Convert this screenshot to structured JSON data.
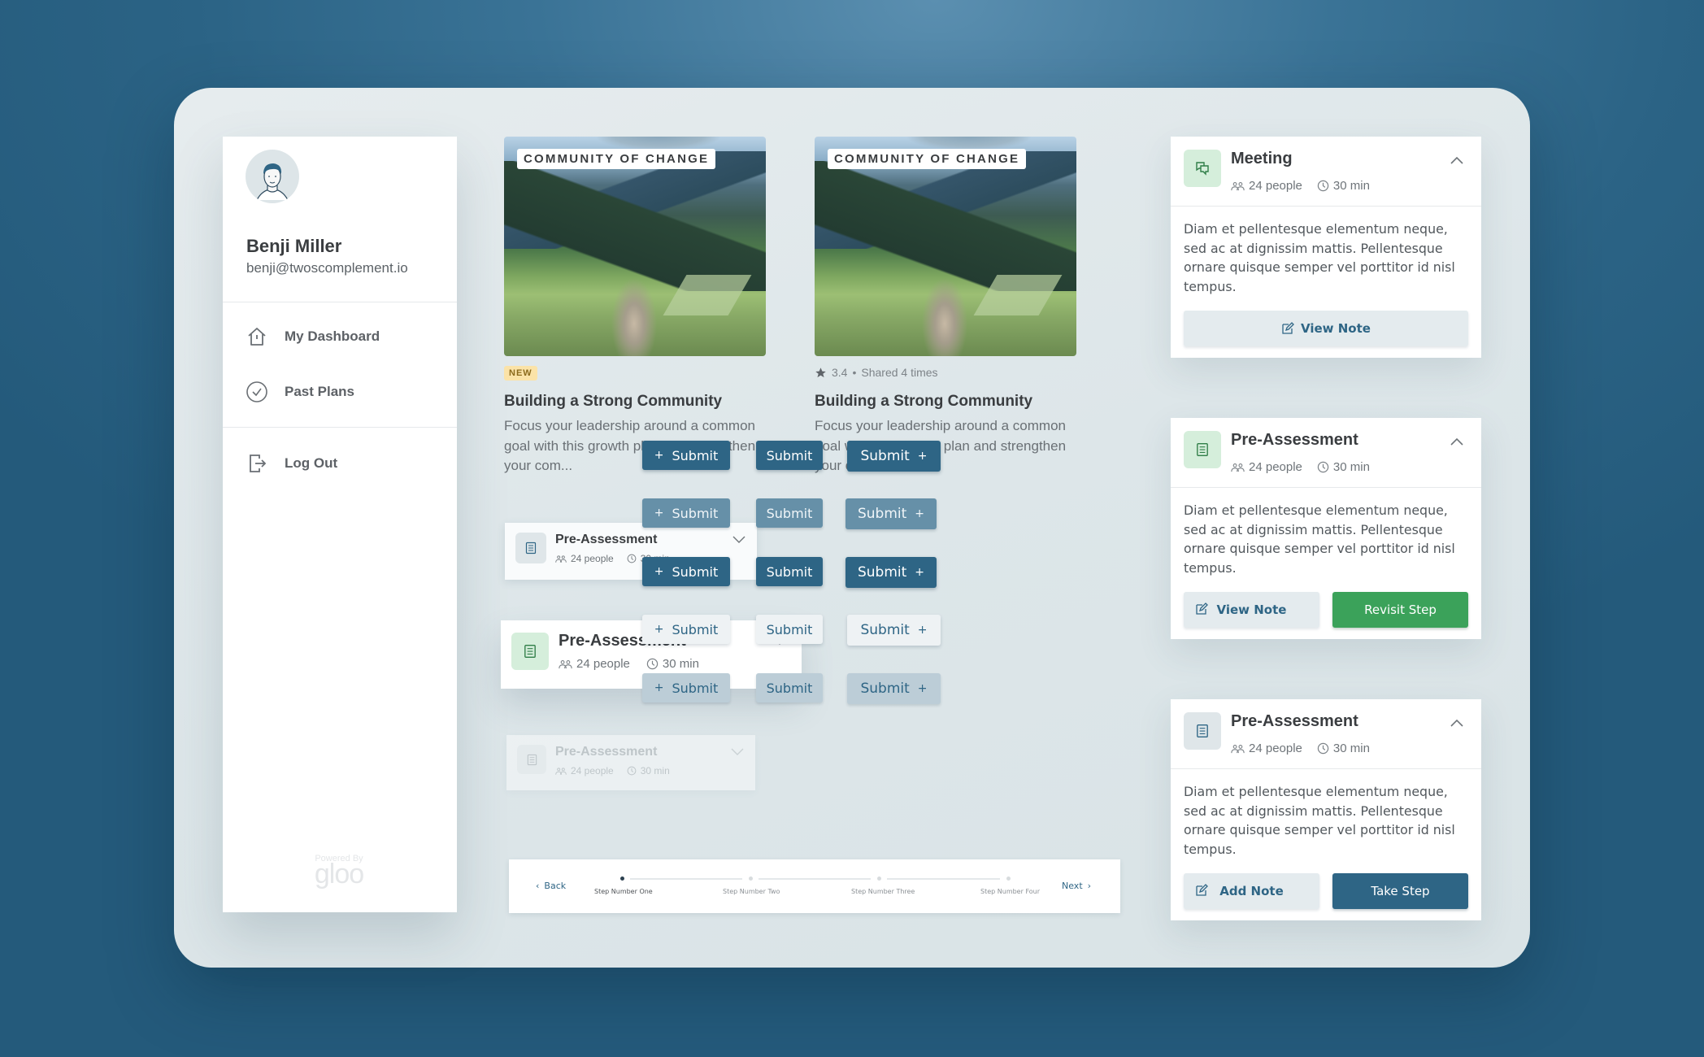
{
  "user": {
    "name": "Benji Miller",
    "email": "benji@twoscomplement.io",
    "avatar_icon": "user-avatar-illustration"
  },
  "sidebar": {
    "items": [
      {
        "label": "My Dashboard",
        "icon": "home-icon"
      },
      {
        "label": "Past Plans",
        "icon": "check-circle-icon"
      },
      {
        "label": "Log Out",
        "icon": "logout-icon"
      }
    ],
    "footer": {
      "powered_by": "Powered By",
      "brand": "gloo"
    }
  },
  "plans": [
    {
      "tag": "COMMUNITY OF CHANGE",
      "badge": "NEW",
      "title": "Building a Strong Community",
      "description": "Focus your leadership around a common goal with this growth plan and strengthen your com..."
    },
    {
      "tag": "COMMUNITY OF CHANGE",
      "rating": "3.4",
      "separator": "•",
      "shared": "Shared 4 times",
      "title": "Building a Strong Community",
      "description": "Focus your leadership around a common goal with this growth plan and strengthen your com..."
    }
  ],
  "step_cards": [
    {
      "title": "Pre-Assessment",
      "people": "24 people",
      "duration": "30 min",
      "state": "default"
    },
    {
      "title": "Pre-Assessment",
      "people": "24 people",
      "duration": "30 min",
      "state": "active"
    },
    {
      "title": "Pre-Assessment",
      "people": "24 people",
      "duration": "30 min",
      "state": "disabled"
    }
  ],
  "buttons": {
    "label": "Submit",
    "plus": "+",
    "rows": [
      "primary",
      "muted",
      "primary-hover",
      "ghost",
      "tint"
    ]
  },
  "stepper": {
    "back": "Back",
    "next": "Next",
    "steps": [
      "Step Number One",
      "Step Number Two",
      "Step Number Three",
      "Step Number Four"
    ],
    "active_index": 0
  },
  "details": [
    {
      "title": "Meeting",
      "icon": "chat-bubbles-icon",
      "people": "24 people",
      "duration": "30 min",
      "body": "Diam et pellentesque elementum neque, sed ac at dignissim mattis. Pellentesque ornare quisque semper vel porttitor id nisl tempus.",
      "actions": [
        {
          "label": "View Note",
          "style": "note"
        }
      ]
    },
    {
      "title": "Pre-Assessment",
      "icon": "list-document-icon",
      "people": "24 people",
      "duration": "30 min",
      "body": "Diam et pellentesque elementum neque, sed ac at dignissim mattis. Pellentesque ornare quisque semper vel porttitor id nisl tempus.",
      "actions": [
        {
          "label": "View Note",
          "style": "note"
        },
        {
          "label": "Revisit Step",
          "style": "green"
        }
      ]
    },
    {
      "title": "Pre-Assessment",
      "icon": "list-document-icon",
      "people": "24 people",
      "duration": "30 min",
      "body": "Diam et pellentesque elementum neque, sed ac at dignissim mattis. Pellentesque ornare quisque semper vel porttitor id nisl tempus.",
      "actions": [
        {
          "label": "Add Note",
          "style": "note"
        },
        {
          "label": "Take Step",
          "style": "blue"
        }
      ]
    }
  ],
  "colors": {
    "brand_blue": "#2e6585",
    "success_green": "#3ba25a",
    "green_tint": "#d5eedb",
    "badge_yellow": "#fbe3a8"
  }
}
